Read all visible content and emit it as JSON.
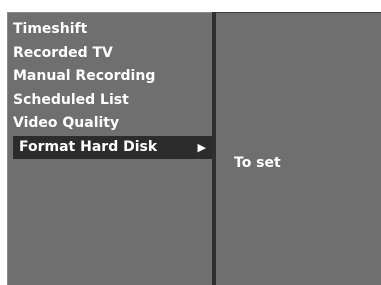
{
  "menu": {
    "items": [
      {
        "label": "Timeshift"
      },
      {
        "label": "Recorded TV"
      },
      {
        "label": "Manual Recording"
      },
      {
        "label": "Scheduled List"
      },
      {
        "label": "Video Quality"
      },
      {
        "label": "Format Hard Disk",
        "selected": true,
        "has_submenu": true
      }
    ],
    "arrow_glyph": "▶",
    "arrow_icon": "play-arrow-icon"
  },
  "submenu": {
    "value": "To set"
  },
  "colors": {
    "panel_bg": "#6f6f6f",
    "selected_bg": "#2c2c2c",
    "divider": "#2f2f2f",
    "text": "#ffffff"
  }
}
